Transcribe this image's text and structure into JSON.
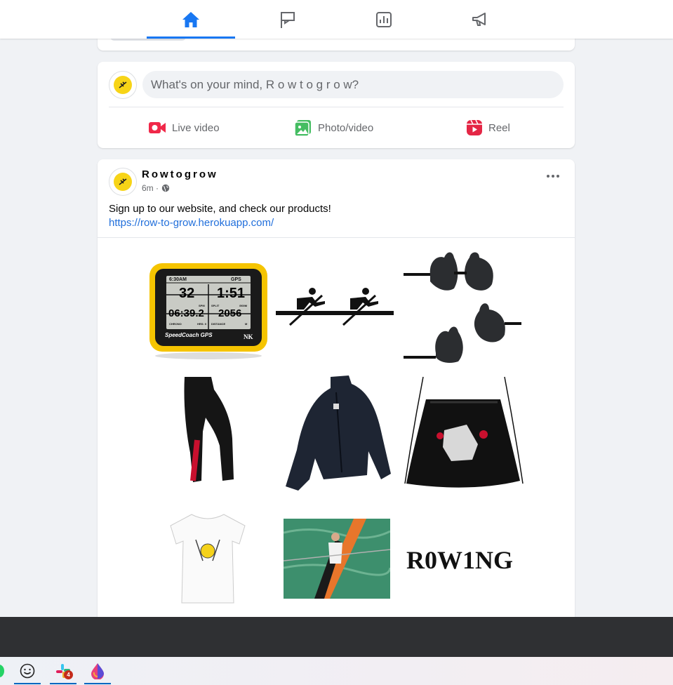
{
  "nav": {
    "tabs": [
      {
        "name": "home",
        "active": true
      },
      {
        "name": "pages",
        "active": false
      },
      {
        "name": "insights",
        "active": false
      },
      {
        "name": "ads",
        "active": false
      }
    ],
    "accent": "#1877f2"
  },
  "composer": {
    "placeholder": "What's on your mind, R o w t o g r o w?",
    "actions": [
      {
        "label": "Live video",
        "icon": "live-video-icon",
        "color": "#f02849"
      },
      {
        "label": "Photo/video",
        "icon": "photo-video-icon",
        "color": "#45bd62"
      },
      {
        "label": "Reel",
        "icon": "reel-icon",
        "color": "#e42645"
      }
    ]
  },
  "post": {
    "author": "Rowtogrow",
    "time": "6m ·",
    "privacy_icon": "globe-icon",
    "text": "Sign up to our website, and check our products!",
    "link": "https://row-to-grow.herokuapp.com/",
    "products": {
      "speedcoach": {
        "time": "6:30AM",
        "gps": "GPS",
        "stroke_rate": "32",
        "split": "1:51",
        "elapsed": "06:39.2",
        "distance": "2056",
        "lbl_spm": "SPM",
        "lbl_split": "SPLIT",
        "lbl_500m": "/500M",
        "lbl_chrono": "CHRONO",
        "lbl_hrs": "HRS: 0",
        "lbl_distance": "DISTANCE",
        "lbl_m": "M",
        "brand": "SpeedCoach GPS",
        "maker": "NK"
      },
      "rowing_text": "R0W1NG"
    }
  },
  "taskbar": {
    "badge": "4"
  }
}
